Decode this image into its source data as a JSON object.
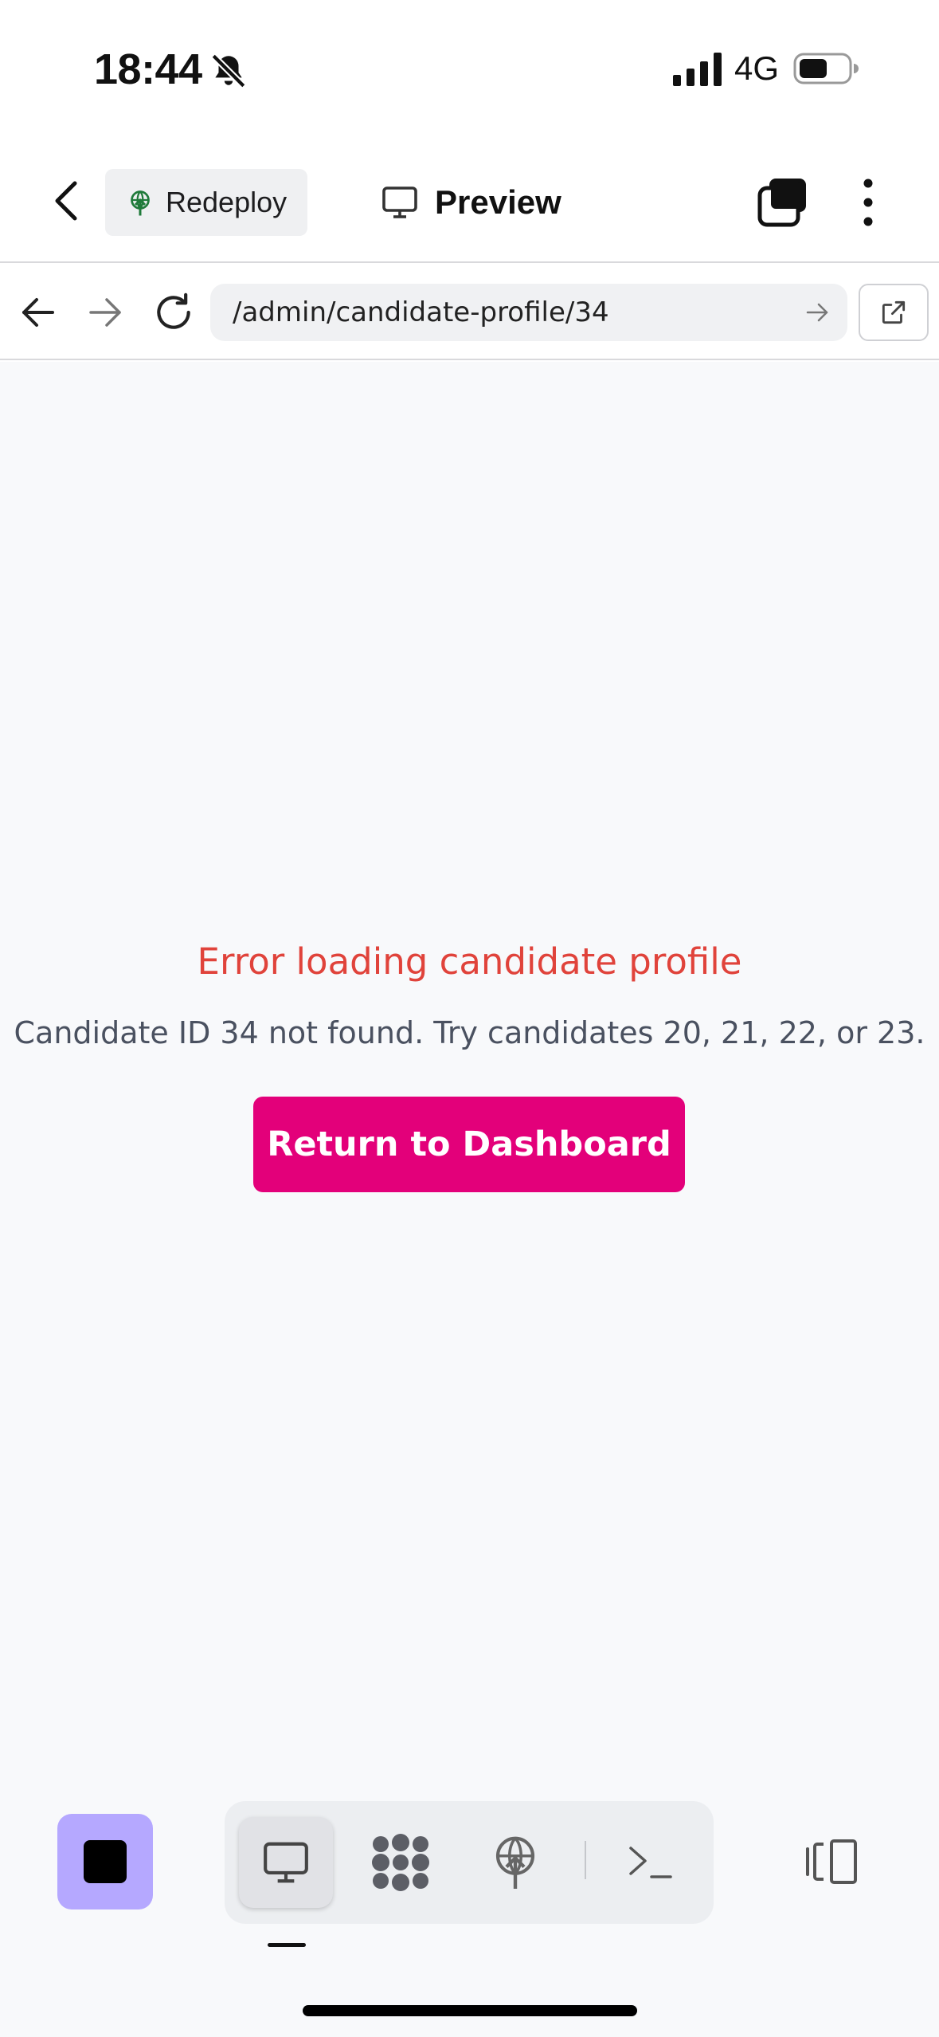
{
  "status_bar": {
    "time": "18:44",
    "network": "4G",
    "icons": [
      "bell-slash-icon",
      "signal-icon",
      "battery-icon"
    ]
  },
  "header": {
    "redeploy_label": "Redeploy",
    "preview_label": "Preview",
    "icons": [
      "back-chevron-icon",
      "globe-upload-icon",
      "monitor-icon",
      "tabs-icon",
      "more-vertical-icon"
    ]
  },
  "browser": {
    "url": "/admin/candidate-profile/34",
    "icons": [
      "arrow-left-icon",
      "arrow-right-icon",
      "reload-icon",
      "go-arrow-icon",
      "external-link-icon"
    ]
  },
  "content": {
    "error_title": "Error loading candidate profile",
    "error_message": "Candidate ID 34 not found. Try candidates 20, 21, 22, or 23.",
    "button_label": "Return to Dashboard"
  },
  "toolbar": {
    "items": [
      "stop",
      "preview",
      "database",
      "deploy",
      "terminal",
      "split-view"
    ],
    "active": "preview"
  },
  "colors": {
    "error": "#e0433b",
    "primary_button": "#e3007a",
    "stop_button": "#b5a8ff",
    "page_background": "#f8f9fb"
  }
}
